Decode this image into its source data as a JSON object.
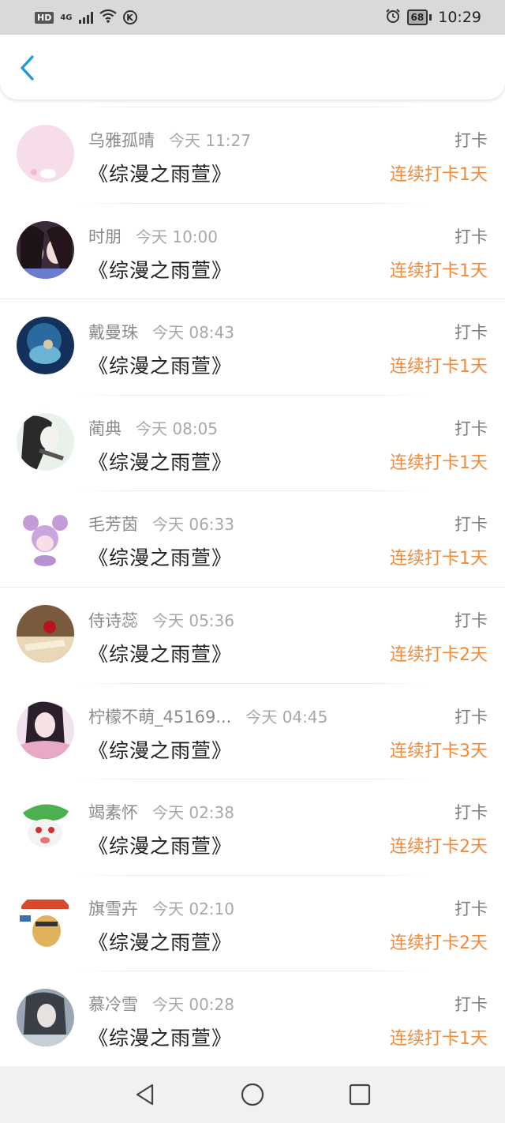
{
  "status_bar": {
    "hd": "HD",
    "network": "4G",
    "battery": "68",
    "time": "10:29",
    "k_badge": "K"
  },
  "colors": {
    "accent": "#1a9ad6",
    "streak": "#f28a3a"
  },
  "list": [
    {
      "name": "乌雅孤晴",
      "time": "今天 11:27",
      "title": "《综漫之雨萱》",
      "type": "打卡",
      "streak": "连续打卡1天"
    },
    {
      "name": "时朋",
      "time": "今天 10:00",
      "title": "《综漫之雨萱》",
      "type": "打卡",
      "streak": "连续打卡1天"
    },
    {
      "name": "戴曼珠",
      "time": "今天 08:43",
      "title": "《综漫之雨萱》",
      "type": "打卡",
      "streak": "连续打卡1天"
    },
    {
      "name": "蔺典",
      "time": "今天 08:05",
      "title": "《综漫之雨萱》",
      "type": "打卡",
      "streak": "连续打卡1天"
    },
    {
      "name": "毛芳茵",
      "time": "今天 06:33",
      "title": "《综漫之雨萱》",
      "type": "打卡",
      "streak": "连续打卡1天"
    },
    {
      "name": "侍诗蕊",
      "time": "今天 05:36",
      "title": "《综漫之雨萱》",
      "type": "打卡",
      "streak": "连续打卡2天"
    },
    {
      "name": "柠檬不萌_45169...",
      "time": "今天 04:45",
      "title": "《综漫之雨萱》",
      "type": "打卡",
      "streak": "连续打卡3天"
    },
    {
      "name": "竭素怀",
      "time": "今天 02:38",
      "title": "《综漫之雨萱》",
      "type": "打卡",
      "streak": "连续打卡2天"
    },
    {
      "name": "旗雪卉",
      "time": "今天 02:10",
      "title": "《综漫之雨萱》",
      "type": "打卡",
      "streak": "连续打卡2天"
    },
    {
      "name": "慕冷雪",
      "time": "今天 00:28",
      "title": "《综漫之雨萱》",
      "type": "打卡",
      "streak": "连续打卡1天"
    }
  ]
}
